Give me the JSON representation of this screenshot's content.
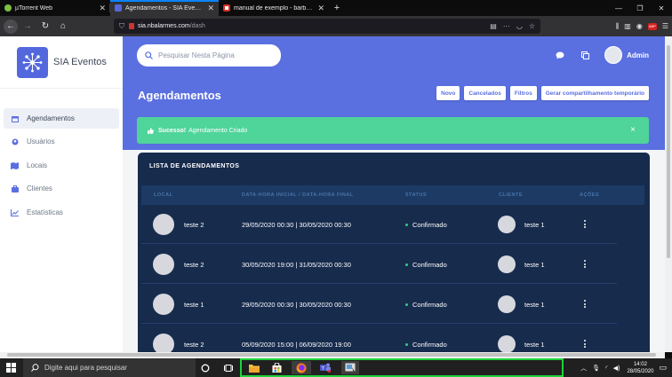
{
  "browser": {
    "tabs": [
      {
        "label": "µTorrent Web",
        "active": false,
        "favicon": "utorrent-icon"
      },
      {
        "label": "Agendamentos - SIA Eventos",
        "active": true,
        "favicon": "sia-icon"
      },
      {
        "label": "manual de exemplo - barbosa",
        "active": false,
        "favicon": "gmail-icon"
      }
    ],
    "new_tab": "+",
    "url_domain": "sia.nbalarmes.com",
    "url_path": "/dash",
    "url_more": "···",
    "ext_badge": "ABP"
  },
  "sidebar": {
    "brand": "SIA Eventos",
    "items": [
      {
        "label": "Agendamentos",
        "icon": "calendar-icon",
        "active": true
      },
      {
        "label": "Usuários",
        "icon": "user-icon",
        "active": false
      },
      {
        "label": "Locais",
        "icon": "map-icon",
        "active": false
      },
      {
        "label": "Clientes",
        "icon": "briefcase-icon",
        "active": false
      },
      {
        "label": "Estatísticas",
        "icon": "chart-icon",
        "active": false
      }
    ]
  },
  "header": {
    "search_placeholder": "Pesquisar Nesta Página",
    "user": "Admin"
  },
  "page": {
    "title": "Agendamentos",
    "buttons": [
      "Novo",
      "Cancelados",
      "Filtros",
      "Gerar compartilhamento temporário"
    ]
  },
  "alert": {
    "strong": "Sucesso!",
    "text": "Agendamento Criado",
    "close": "×",
    "color": "#4fd49a"
  },
  "table": {
    "title": "LISTA DE AGENDAMENTOS",
    "columns": [
      "LOCAL",
      "DATA-HORA INICIAL / DATA-HORA FINAL",
      "STATUS",
      "CLIENTE",
      "AÇÕES"
    ],
    "rows": [
      {
        "local": "teste 2",
        "datetime": "29/05/2020 00:30 | 30/05/2020 00:30",
        "status": "Confirmado",
        "client": "teste 1"
      },
      {
        "local": "teste 2",
        "datetime": "30/05/2020 19:00 | 31/05/2020 00:30",
        "status": "Confirmado",
        "client": "teste 1"
      },
      {
        "local": "teste 1",
        "datetime": "29/05/2020 00:30 | 30/05/2020 00:30",
        "status": "Confirmado",
        "client": "teste 1"
      },
      {
        "local": "teste 2",
        "datetime": "05/09/2020 15:00 | 06/09/2020 19:00",
        "status": "Confirmado",
        "client": "teste 1"
      }
    ]
  },
  "taskbar": {
    "search_placeholder": "Digite aqui para pesquisar",
    "time": "14:02",
    "date": "28/05/2020",
    "highlight_color": "#1ed33b"
  }
}
